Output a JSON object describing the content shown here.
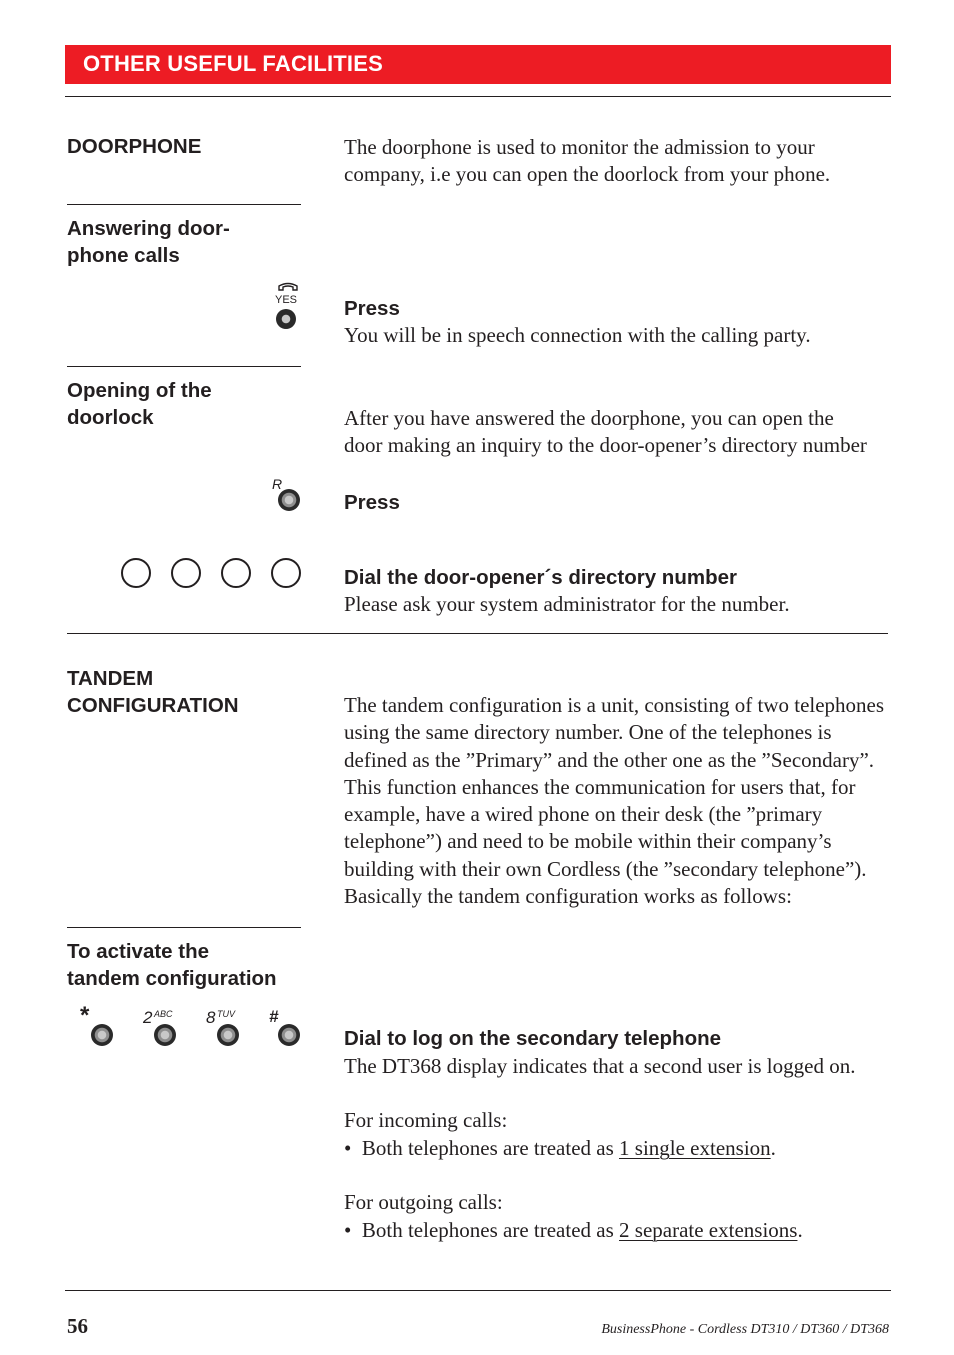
{
  "header": {
    "title": "OTHER USEFUL FACILITIES"
  },
  "doorphone": {
    "heading": "DOORPHONE",
    "intro_lines": [
      "The doorphone is used to monitor the admission to your",
      "company, i.e you can open the doorlock from your phone."
    ]
  },
  "answering": {
    "heading_lines": [
      "Answering door-",
      "phone calls"
    ],
    "key_label": "YES",
    "step_title": "Press",
    "step_text": "You will be in speech connection with the calling party."
  },
  "doorlock": {
    "heading_lines": [
      "Opening of the",
      "doorlock"
    ],
    "intro_lines": [
      "After you have answered the doorphone, you can open the",
      "door making an inquiry to the door-opener’s directory number"
    ],
    "key_label": "R",
    "press_title": "Press",
    "dial_title": "Dial the door-opener´s directory number",
    "dial_text": "Please ask your system administrator for the number."
  },
  "tandem": {
    "heading_lines": [
      "TANDEM",
      "CONFIGURATION"
    ],
    "body_lines": [
      "The tandem configuration is a unit, consisting of two telephones",
      "using the same directory number. One of the telephones is",
      "defined as the ”Primary” and the other one as the ”Secondary”.",
      "This function enhances the communication for users that, for",
      "example, have a wired phone on their desk (the ”primary",
      "telephone”) and need to be mobile within their company’s",
      "building with their own Cordless (the ”secondary telephone”).",
      "Basically the tandem configuration works as follows:"
    ]
  },
  "activate": {
    "heading_lines": [
      "To activate the",
      "tandem configuration"
    ],
    "keys": [
      {
        "main": "*",
        "sup": ""
      },
      {
        "main": "2",
        "sup": "ABC"
      },
      {
        "main": "8",
        "sup": "TUV"
      },
      {
        "main": "#",
        "sup": ""
      }
    ],
    "step_title": "Dial to log on the secondary telephone",
    "step_text": "The DT368 display indicates that a second user is logged on.",
    "incoming_label": "For incoming calls:",
    "incoming_bullet_prefix": "Both telephones are treated as ",
    "incoming_bullet_emph": "1 single extension",
    "incoming_bullet_suffix": ".",
    "outgoing_label": "For outgoing calls:",
    "outgoing_bullet_prefix": "Both telephones are treated as ",
    "outgoing_bullet_emph": "2 separate extensions",
    "outgoing_bullet_suffix": ".",
    "bullet": "•"
  },
  "footer": {
    "page_number": "56",
    "product": "BusinessPhone - Cordless DT310 / DT360 / DT368"
  },
  "colors": {
    "banner": "#ed1c24",
    "text": "#231f20"
  }
}
